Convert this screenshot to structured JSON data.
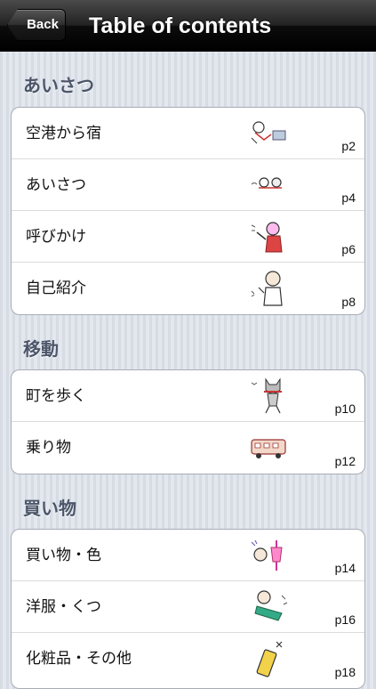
{
  "navbar": {
    "back_label": "Back",
    "title": "Table of contents"
  },
  "sections": [
    {
      "header": "あいさつ",
      "items": [
        {
          "title": "空港から宿",
          "page": "p2",
          "icon": "airport-illustration-icon"
        },
        {
          "title": "あいさつ",
          "page": "p4",
          "icon": "greeting-illustration-icon"
        },
        {
          "title": "呼びかけ",
          "page": "p6",
          "icon": "calling-illustration-icon"
        },
        {
          "title": "自己紹介",
          "page": "p8",
          "icon": "introduction-illustration-icon"
        }
      ]
    },
    {
      "header": "移動",
      "items": [
        {
          "title": "町を歩く",
          "page": "p10",
          "icon": "walking-cat-illustration-icon"
        },
        {
          "title": "乗り物",
          "page": "p12",
          "icon": "bus-illustration-icon"
        }
      ]
    },
    {
      "header": "買い物",
      "items": [
        {
          "title": "買い物・色",
          "page": "p14",
          "icon": "shopping-illustration-icon"
        },
        {
          "title": "洋服・くつ",
          "page": "p16",
          "icon": "clothes-illustration-icon"
        },
        {
          "title": "化粧品・その他",
          "page": "p18",
          "icon": "cosmetics-illustration-icon"
        }
      ]
    }
  ]
}
